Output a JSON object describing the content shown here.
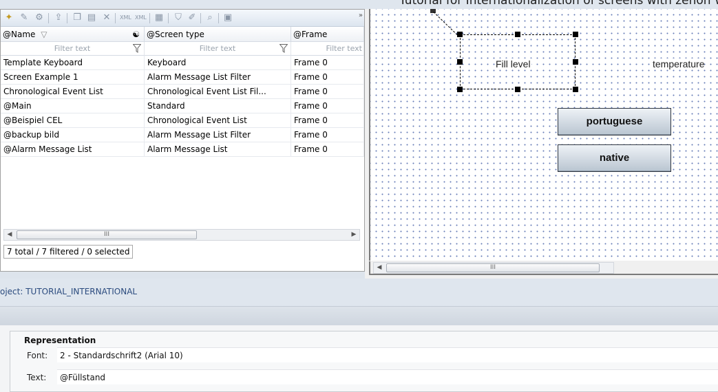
{
  "top_strip": {
    "text": "Tutorial for Internationalization of screens with zenon Workspace & Runtime"
  },
  "toolbar": {
    "icons": [
      "new-wand-icon",
      "edit-icon",
      "gear-icon",
      "export-icon",
      "copy-icon",
      "paste-icon",
      "delete-icon",
      "xml-export-icon",
      "xml-import-icon",
      "replace-icon",
      "filter-icon",
      "edit-pen-icon",
      "search-icon",
      "open-icon"
    ],
    "more_label": "»"
  },
  "table": {
    "columns": [
      {
        "label": "@Name",
        "filter": "Filter text"
      },
      {
        "label": "@Screen type",
        "filter": "Filter text"
      },
      {
        "label": "@Frame",
        "filter": "Filter text"
      }
    ],
    "rows": [
      [
        "Template Keyboard",
        "Keyboard",
        "Frame 0"
      ],
      [
        "Screen Example 1",
        "Alarm Message List Filter",
        "Frame 0"
      ],
      [
        "Chronological Event List",
        "Chronological Event List Fil...",
        "Frame 0"
      ],
      [
        "@Main",
        "Standard",
        "Frame 0"
      ],
      [
        "@Beispiel CEL",
        "Chronological Event List",
        "Frame 0"
      ],
      [
        "@backup bild",
        "Alarm Message List Filter",
        "Frame 0"
      ],
      [
        "@Alarm Message List",
        "Alarm Message List",
        "Frame 0"
      ]
    ],
    "sort_indicator": "▽",
    "scroll_left": "◀",
    "scroll_right": "▶",
    "thumb_grip": "III",
    "status": "7 total / 7 filtered / 0 selected"
  },
  "canvas": {
    "fill_level_label": "Fill level",
    "temperature_label": "temperature",
    "buttons": [
      "portuguese",
      "native"
    ],
    "scroll_left": "◀",
    "thumb_grip": "III"
  },
  "project": {
    "text": "oject: TUTORIAL_INTERNATIONAL"
  },
  "properties": {
    "group_title": "Representation",
    "font_label": "Font:",
    "font_value": "2 - Standardschrift2 (Arial 10)",
    "text_label": "Text:",
    "text_value": "@Füllstand"
  },
  "colors": {
    "accent_text": "#2b4b7e",
    "button_gradient_top": "#eef2f6",
    "button_gradient_bottom": "#b9c5d1"
  }
}
